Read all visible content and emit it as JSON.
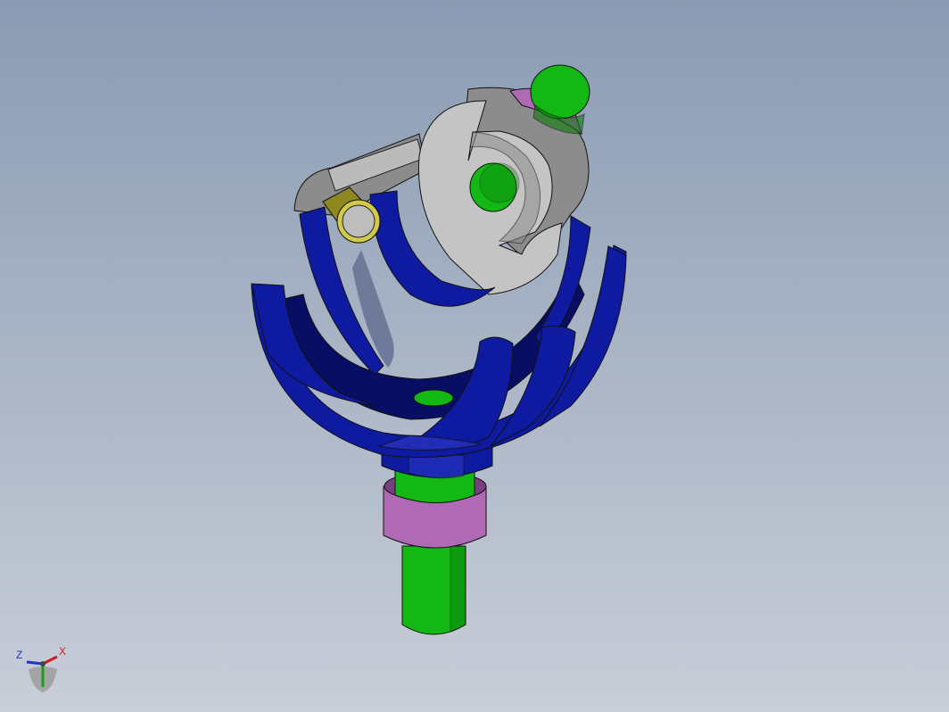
{
  "viewport": {
    "background_top": "#8a9bb3",
    "background_bottom": "#c9ced8"
  },
  "model": {
    "colors": {
      "bowl_blue": "#0e1aa0",
      "bowl_blue_light": "#2a36c4",
      "bowl_blue_dark": "#070e63",
      "bracket_gray": "#c4c4c4",
      "bracket_gray_dark": "#8c8c8c",
      "shaft_green": "#14b814",
      "shaft_green_dark": "#0a7a0a",
      "collar_pink": "#b06ab5",
      "collar_pink_dark": "#7a3f80",
      "pin_yellow": "#d2c84a",
      "pin_yellow_dark": "#8f8820"
    }
  },
  "triad": {
    "z_label": "Z",
    "x_label": "X",
    "z_color": "#1a35c9",
    "x_color": "#d01a1a",
    "y_color": "#17a017"
  }
}
